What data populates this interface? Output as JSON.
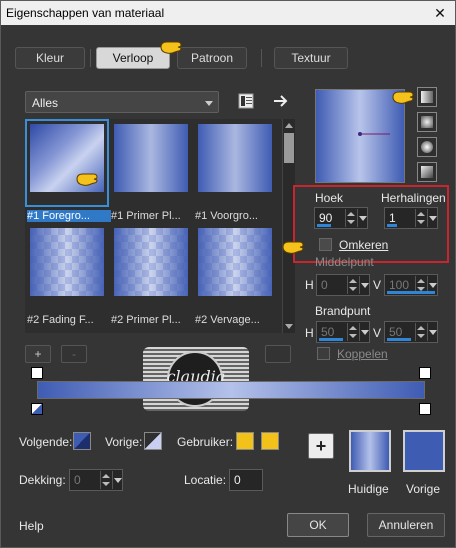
{
  "window": {
    "title": "Eigenschappen van materiaal",
    "close_glyph": "✕"
  },
  "tabs": [
    {
      "label": "Kleur",
      "active": false
    },
    {
      "label": "Verloop",
      "active": true
    },
    {
      "label": "Patroon",
      "active": false
    },
    {
      "label": "Textuur",
      "active": false
    }
  ],
  "category": {
    "value": "Alles"
  },
  "gallery": {
    "items": [
      {
        "label": "#1 Foregro...",
        "style": "diag",
        "selected": true
      },
      {
        "label": "#1 Primer Pl...",
        "style": "linear",
        "selected": false
      },
      {
        "label": "#1 Voorgro...",
        "style": "linear",
        "selected": false
      },
      {
        "label": "#2 Fading F...",
        "style": "checker",
        "selected": false
      },
      {
        "label": "#2 Primer Pl...",
        "style": "checker",
        "selected": false
      },
      {
        "label": "#2 Vervage...",
        "style": "checker",
        "selected": false
      }
    ]
  },
  "props": {
    "hoek_label": "Hoek",
    "hoek_value": "90",
    "herhalingen_label": "Herhalingen",
    "herhalingen_value": "1",
    "omkeren_label": "Omkeren",
    "middelpunt_label": "Middelpunt",
    "h_label": "H",
    "v_label": "V",
    "middel_h": "0",
    "middel_v": "100",
    "brandpunt_label": "Brandpunt",
    "brand_h": "50",
    "brand_v": "50",
    "koppelen_label": "Koppelen"
  },
  "editor": {
    "add_label": "+",
    "remove_label": "-"
  },
  "watermark": {
    "text": "claudia"
  },
  "bottom": {
    "volgende_label": "Volgende:",
    "vorige_label": "Vorige:",
    "gebruiker_label": "Gebruiker:",
    "dekking_label": "Dekking:",
    "dekking_value": "0",
    "locatie_label": "Locatie:",
    "locatie_value": "0",
    "add_color_label": "+",
    "huidige_label": "Huidige",
    "vorige_color_label": "Vorige"
  },
  "footer": {
    "help_label": "Help",
    "ok_label": "OK",
    "cancel_label": "Annuleren"
  },
  "colors": {
    "gradient_blue": "#3f5cb3",
    "gradient_light": "#b4c1ea",
    "user_yellow": "#f2c21b",
    "selection": "#2f79c7",
    "red_frame": "#c8252c"
  }
}
